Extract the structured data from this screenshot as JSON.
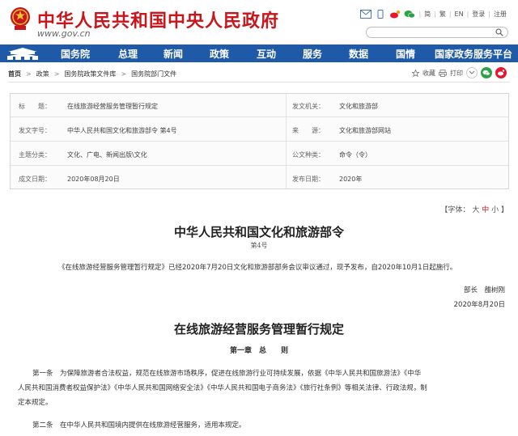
{
  "header": {
    "title": "中华人民共和国中央人民政府",
    "url": "www.gov.cn",
    "top_links": [
      "简",
      "繁",
      "EN",
      "登录",
      "注册"
    ],
    "search_placeholder": ""
  },
  "nav": {
    "items": [
      "国务院",
      "总理",
      "新闻",
      "政策",
      "互动",
      "服务",
      "数据",
      "国情",
      "国家政务服务平台"
    ]
  },
  "breadcrumb": {
    "items": [
      "首页",
      "政策",
      "国务院政策文件库",
      "国务院部门文件"
    ]
  },
  "tools": {
    "favorite": "收藏",
    "print": "打印"
  },
  "info": {
    "rows": [
      {
        "l1": "标　　题：",
        "v1": "在线旅游经营服务管理暂行规定",
        "l2": "发文机关：",
        "v2": "文化和旅游部"
      },
      {
        "l1": "发文字号：",
        "v1": "中华人民共和国文化和旅游部令 第4号",
        "l2": "来　　源：",
        "v2": "文化和旅游部网站"
      },
      {
        "l1": "主题分类：",
        "v1": "文化、广电、新闻出版\\文化",
        "l2": "公文种类：",
        "v2": "命令（令）"
      },
      {
        "l1": "成文日期：",
        "v1": "2020年08月20日",
        "l2": "发布日期：",
        "v2": "2020年"
      }
    ]
  },
  "font_size": {
    "prefix": "【字体：",
    "large": "大",
    "medium": "中",
    "small": "小",
    "suffix": "】"
  },
  "document": {
    "issuer": "中华人民共和国文化和旅游部令",
    "number": "第4号",
    "preamble": "《在线旅游经营服务管理暂行规定》已经2020年7月20日文化和旅游部部务会议审议通过，现予发布，自2020年10月1日起施行。",
    "signer": "部长　雒树刚",
    "sign_date": "2020年8月20日",
    "title": "在线旅游经营服务管理暂行规定",
    "chapter": "第一章　总　　则",
    "art1_l1": "第一条　为保障旅游者合法权益，规范在线旅游市场秩序，促进在线旅游行业可持续发展，依据《中华人民共和国旅游法》《中华",
    "art1_l2": "人民共和国消费者权益保护法》《中华人民共和国网络安全法》《中华人民共和国电子商务法》《旅行社条例》等相关法律、行政法规，制",
    "art1_l3": "定本规定。",
    "art2": "第二条　在中华人民共和国境内提供在线旅游经营服务，适用本规定。"
  },
  "colors": {
    "brand_red": "#c8161d",
    "nav_blue": "#1e5aa8"
  }
}
